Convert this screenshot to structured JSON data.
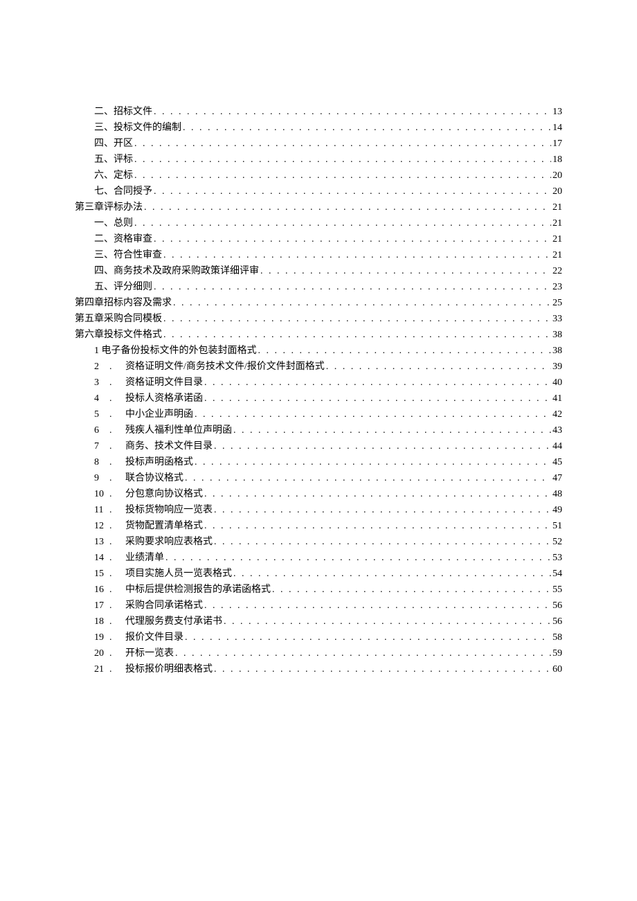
{
  "toc": [
    {
      "indent": 1,
      "prefix": "二、",
      "title": "招标文件",
      "page": "13",
      "numbered": false
    },
    {
      "indent": 1,
      "prefix": "三、",
      "title": "投标文件的编制",
      "page": "14",
      "numbered": false
    },
    {
      "indent": 1,
      "prefix": "四、",
      "title": "开区",
      "page": "17",
      "numbered": false
    },
    {
      "indent": 1,
      "prefix": "五、",
      "title": "评标",
      "page": "18",
      "numbered": false
    },
    {
      "indent": 1,
      "prefix": "六、",
      "title": "定标",
      "page": "20",
      "numbered": false
    },
    {
      "indent": 1,
      "prefix": "七、",
      "title": "合同授予",
      "page": "20",
      "numbered": false
    },
    {
      "indent": 0,
      "prefix": "",
      "title": "第三章评标办法",
      "page": "21",
      "numbered": false
    },
    {
      "indent": 1,
      "prefix": "一、",
      "title": "总则",
      "page": "21",
      "numbered": false
    },
    {
      "indent": 1,
      "prefix": "二、",
      "title": "资格审查",
      "page": "21",
      "numbered": false
    },
    {
      "indent": 1,
      "prefix": "三、",
      "title": "符合性审查",
      "page": "21",
      "numbered": false
    },
    {
      "indent": 1,
      "prefix": "四、",
      "title": "商务技术及政府采购政策详细评审",
      "page": "22",
      "numbered": false
    },
    {
      "indent": 1,
      "prefix": "五、",
      "title": "评分细则",
      "page": "23",
      "numbered": false
    },
    {
      "indent": 0,
      "prefix": "",
      "title": "第四章招标内容及需求",
      "page": "25",
      "numbered": false
    },
    {
      "indent": 0,
      "prefix": "",
      "title": "第五章采购合同模板",
      "page": "33",
      "numbered": false
    },
    {
      "indent": 0,
      "prefix": "",
      "title": "第六章投标文件格式",
      "page": "38",
      "numbered": false
    },
    {
      "indent": 1,
      "prefix": "1 ",
      "title": "电子备份投标文件的外包装封面格式",
      "page": "38",
      "numbered": false
    },
    {
      "indent": 1,
      "prefix": "2",
      "title": "资格证明文件/商务技术文件/报价文件封面格式",
      "page": "39",
      "numbered": true
    },
    {
      "indent": 1,
      "prefix": "3",
      "title": "资格证明文件目录",
      "page": "40",
      "numbered": true
    },
    {
      "indent": 1,
      "prefix": "4",
      "title": "投标人资格承诺函",
      "page": "41",
      "numbered": true
    },
    {
      "indent": 1,
      "prefix": "5",
      "title": "中小企业声明函",
      "page": "42",
      "numbered": true
    },
    {
      "indent": 1,
      "prefix": "6",
      "title": "残疾人福利性单位声明函",
      "page": "43",
      "numbered": true
    },
    {
      "indent": 1,
      "prefix": "7",
      "title": "商务、技术文件目录",
      "page": "44",
      "numbered": true
    },
    {
      "indent": 1,
      "prefix": "8",
      "title": "投标声明函格式",
      "page": "45",
      "numbered": true
    },
    {
      "indent": 1,
      "prefix": "9",
      "title": "联合协议格式",
      "page": "47",
      "numbered": true
    },
    {
      "indent": 1,
      "prefix": "10",
      "title": "分包意向协议格式",
      "page": "48",
      "numbered": true
    },
    {
      "indent": 1,
      "prefix": "11",
      "title": "投标货物响应一览表",
      "page": "49",
      "numbered": true
    },
    {
      "indent": 1,
      "prefix": "12",
      "title": "货物配置清单格式",
      "page": "51",
      "numbered": true
    },
    {
      "indent": 1,
      "prefix": "13",
      "title": "采购要求响应表格式",
      "page": "52",
      "numbered": true
    },
    {
      "indent": 1,
      "prefix": "14",
      "title": "业绩清单",
      "page": "53",
      "numbered": true
    },
    {
      "indent": 1,
      "prefix": "15",
      "title": "项目实施人员一览表格式",
      "page": "54",
      "numbered": true
    },
    {
      "indent": 1,
      "prefix": "16",
      "title": "中标后提供检测报告的承诺函格式",
      "page": "55",
      "numbered": true
    },
    {
      "indent": 1,
      "prefix": "17",
      "title": "采购合同承诺格式",
      "page": "56",
      "numbered": true
    },
    {
      "indent": 1,
      "prefix": "18",
      "title": "代理服务费支付承诺书",
      "page": "56",
      "numbered": true
    },
    {
      "indent": 1,
      "prefix": "19",
      "title": "报价文件目录",
      "page": "58",
      "numbered": true
    },
    {
      "indent": 1,
      "prefix": "20",
      "title": "开标一览表",
      "page": "59",
      "numbered": true
    },
    {
      "indent": 1,
      "prefix": "21",
      "title": "投标报价明细表格式",
      "page": "60",
      "numbered": true
    }
  ]
}
